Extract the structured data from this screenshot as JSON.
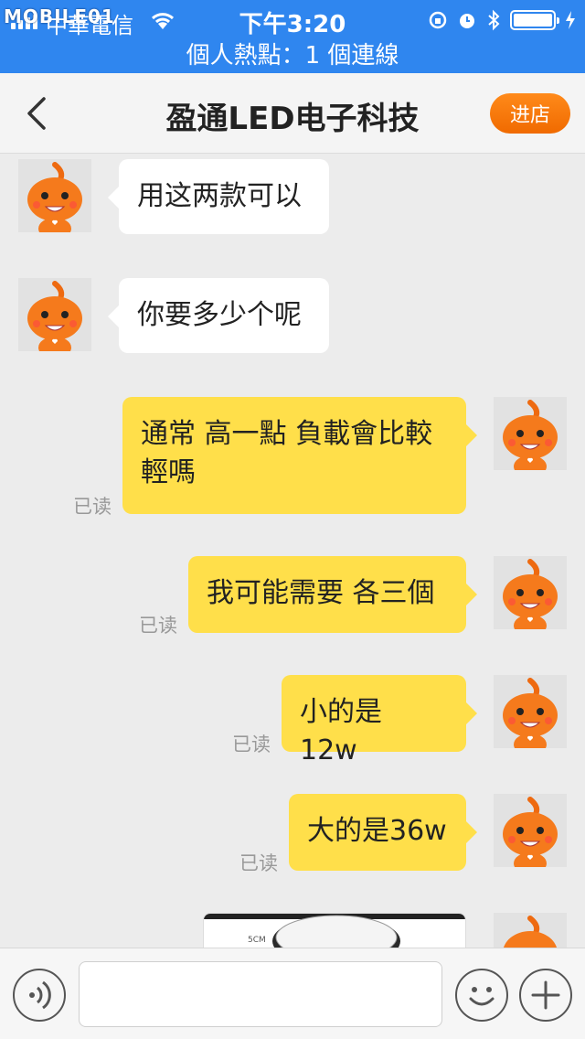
{
  "status_bar": {
    "watermark": "MOBILE01",
    "carrier": "中華電信",
    "time": "下午3:20",
    "hotspot": "個人熱點：1 個連線"
  },
  "nav": {
    "title": "盈通LED电子科技",
    "shop_button": "进店"
  },
  "messages": [
    {
      "side": "in",
      "text": "用这两款可以"
    },
    {
      "side": "in",
      "text": "你要多少个呢"
    },
    {
      "side": "out",
      "text": "通常 高一點 負載會比較輕嗎",
      "status": "已读"
    },
    {
      "side": "out",
      "text": "我可能需要 各三個",
      "status": "已读"
    },
    {
      "side": "out",
      "text": "小的是 12w",
      "status": "已读"
    },
    {
      "side": "out",
      "text": "大的是36w",
      "status": "已读"
    }
  ],
  "image_message": {
    "label": "5CM"
  },
  "colors": {
    "status_bar": "#2f86ef",
    "out_bubble": "#ffdf4a",
    "in_bubble": "#ffffff",
    "shop_button": "#f57a00",
    "background": "#ececec"
  }
}
